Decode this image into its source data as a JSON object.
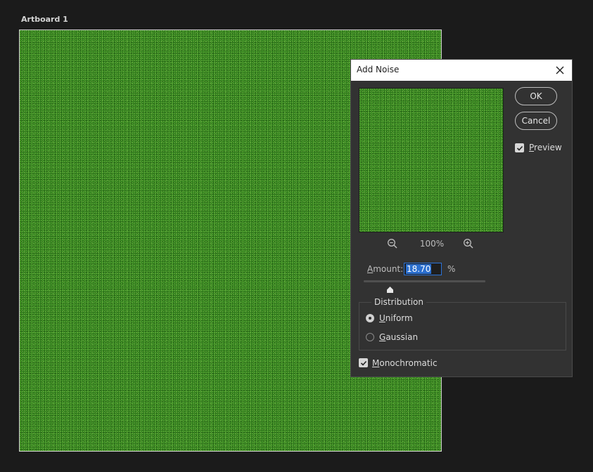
{
  "artboard": {
    "label": "Artboard 1"
  },
  "dialog": {
    "title": "Add Noise",
    "ok_label": "OK",
    "cancel_label": "Cancel",
    "preview": {
      "label_accel": "P",
      "label_rest": "review",
      "checked": true
    },
    "zoom_level": "100%",
    "amount": {
      "label_accel": "A",
      "label_rest": "mount:",
      "value": "18.70",
      "unit": "%"
    },
    "distribution": {
      "title": "Distribution",
      "uniform": {
        "accel": "U",
        "rest": "niform",
        "selected": true
      },
      "gaussian": {
        "accel": "G",
        "rest": "aussian",
        "selected": false
      }
    },
    "monochromatic": {
      "accel": "M",
      "rest": "onochromatic",
      "checked": true
    }
  },
  "colors": {
    "noise_base": "#2f7d1c",
    "dialog_bg": "#323232",
    "selection": "#2b6fcf"
  }
}
